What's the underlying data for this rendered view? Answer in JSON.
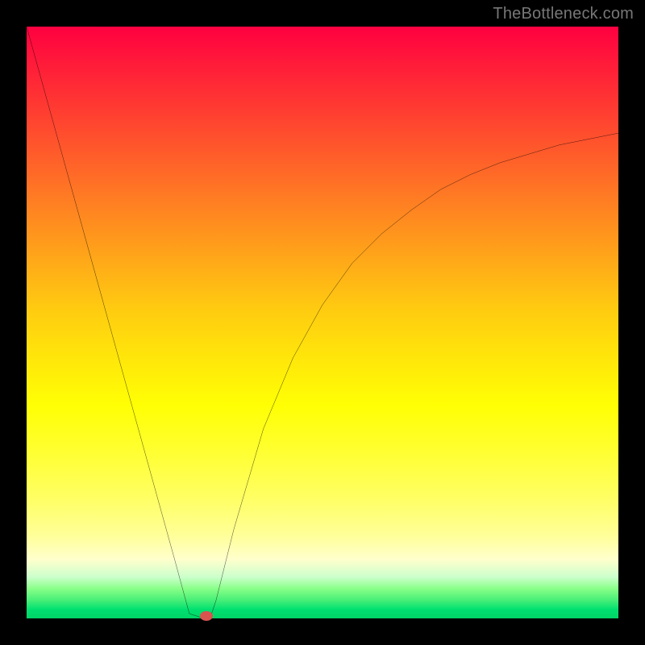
{
  "watermark": "TheBottleneck.com",
  "colors": {
    "frame": "#000000",
    "curve": "#000000",
    "marker": "#d9534f",
    "watermark": "#777777"
  },
  "chart_data": {
    "type": "line",
    "title": "",
    "xlabel": "",
    "ylabel": "",
    "xlim": [
      0,
      100
    ],
    "ylim": [
      0,
      100
    ],
    "grid": false,
    "legend": false,
    "series": [
      {
        "name": "bottleneck-curve",
        "x": [
          0,
          5,
          10,
          15,
          20,
          25,
          27.5,
          30,
          31,
          32,
          35,
          40,
          45,
          50,
          55,
          60,
          65,
          70,
          75,
          80,
          85,
          90,
          95,
          100
        ],
        "values": [
          100,
          82,
          64,
          46,
          28,
          10,
          0.8,
          0,
          0,
          3,
          15,
          32,
          44,
          53,
          60,
          65,
          69,
          72.5,
          75,
          77,
          78.5,
          80,
          81,
          82
        ]
      }
    ],
    "annotations": [
      {
        "name": "minimum-marker",
        "x": 30.4,
        "y": 0.4
      }
    ]
  }
}
